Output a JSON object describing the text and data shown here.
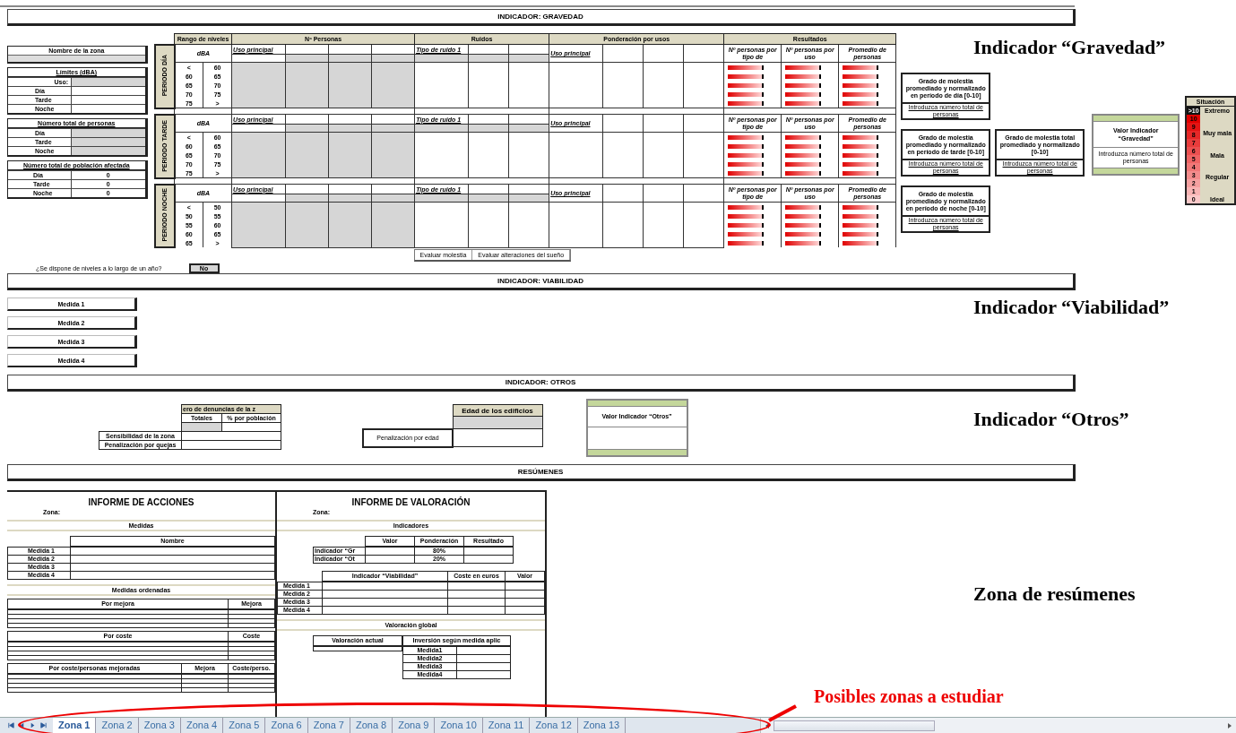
{
  "gravedad": {
    "title": "INDICADOR: GRAVEDAD",
    "zone": {
      "label": "Nombre de la zona"
    },
    "limits": {
      "title": "Límites (dBA)",
      "use_label": "Uso:",
      "rows": [
        "Día",
        "Tarde",
        "Noche"
      ]
    },
    "people": {
      "title": "Número total de personas",
      "rows": [
        "Día",
        "Tarde",
        "Noche"
      ]
    },
    "affected": {
      "title": "Número total de población afectada",
      "rows": [
        {
          "label": "Día",
          "value": "0"
        },
        {
          "label": "Tarde",
          "value": "0"
        },
        {
          "label": "Noche",
          "value": "0"
        }
      ]
    },
    "columns": {
      "range": "Rango de niveles",
      "persons": "Nº Personas",
      "noise": "Ruidos",
      "weighting": "Ponderación por usos",
      "results": "Resultados"
    },
    "periods": [
      {
        "label": "PERIODO DÍA",
        "unit": "dBA",
        "persons_header": "Uso principal",
        "noise_header": "Tipo de ruido 1",
        "weighting_header": "Uso principal",
        "result_headers": [
          "Nº personas por tipo de",
          "Nº personas por uso",
          "Promedio de personas"
        ],
        "ranges": [
          [
            "<",
            "60"
          ],
          [
            "60",
            "65"
          ],
          [
            "65",
            "70"
          ],
          [
            "70",
            "75"
          ],
          [
            "75",
            ">"
          ]
        ]
      },
      {
        "label": "PERIODO TARDE",
        "unit": "dBA",
        "persons_header": "Uso principal",
        "noise_header": "Tipo de ruido 1",
        "weighting_header": "Uso principal",
        "result_headers": [
          "Nº personas por tipo de",
          "Nº personas por uso",
          "Promedio de personas"
        ],
        "ranges": [
          [
            "<",
            "60"
          ],
          [
            "60",
            "65"
          ],
          [
            "65",
            "70"
          ],
          [
            "70",
            "75"
          ],
          [
            "75",
            ">"
          ]
        ]
      },
      {
        "label": "PERIODO NOCHE",
        "unit": "dBA",
        "persons_header": "Uso principal",
        "noise_header": "Tipo de ruido 1",
        "weighting_header": "Uso principal",
        "result_headers": [
          "Nº personas por tipo de",
          "Nº personas por uso",
          "Promedio de personas"
        ],
        "ranges": [
          [
            "<",
            "50"
          ],
          [
            "50",
            "55"
          ],
          [
            "55",
            "60"
          ],
          [
            "60",
            "65"
          ],
          [
            "65",
            ">"
          ]
        ]
      }
    ],
    "actions": [
      "Evaluar molestia",
      "Evaluar alteraciones del sueño"
    ],
    "summary_boxes": [
      {
        "title": "Grado de molestia promediado y normalizado en período de día [0-10]",
        "note": "Introduzca número total de personas"
      },
      {
        "title": "Grado de molestia promediado y normalizado en período de tarde [0-10]",
        "note": "Introduzca número total de personas"
      },
      {
        "title": "Grado de molestia total promediado y normalizado [0-10]",
        "note": "Introduzca número total de personas"
      },
      {
        "title": "Grado de molestia promediado y normalizado en período de noche [0-10]",
        "note": "Introduzca número total de personas"
      }
    ],
    "indicator": {
      "title": "Valor Indicador “Gravedad”",
      "note": "Introduzca número total de personas"
    },
    "scale": {
      "title": "Situación",
      "steps": [
        ">10",
        "10",
        "9",
        "8",
        "7",
        "6",
        "5",
        "4",
        "3",
        "2",
        "1",
        "0"
      ],
      "labels": [
        "Extremo",
        "Muy mala",
        "Mala",
        "Regular",
        "Ideal"
      ]
    },
    "question": {
      "text": "¿Se dispone de niveles a lo largo de un año?",
      "answer": "No"
    }
  },
  "viabilidad": {
    "title": "INDICADOR: VIABILIDAD",
    "measures": [
      "Medida 1",
      "Medida 2",
      "Medida 3",
      "Medida 4"
    ]
  },
  "otros": {
    "title": "INDICADOR: OTROS",
    "complaints": {
      "header": "ero de denuncias de la z",
      "subheaders": [
        "Totales",
        "% por población"
      ],
      "rows": [
        "Sensibilidad de la zona",
        "Penalización por quejas"
      ]
    },
    "age": {
      "header": "Edad de los edificios",
      "row": "Penalización por edad"
    },
    "indicator": {
      "title": "Valor Indicador “Otros”"
    }
  },
  "resumenes": {
    "title": "RESÚMENES",
    "acciones": {
      "title": "INFORME DE ACCIONES",
      "zone": "Zona:",
      "measures_band": "Medidas",
      "name_header": "Nombre",
      "measures": [
        "Medida 1",
        "Medida 2",
        "Medida 3",
        "Medida 4"
      ],
      "ordered_band": "Medidas ordenadas",
      "tables": [
        {
          "headers": [
            "Por mejora",
            "Mejora"
          ]
        },
        {
          "headers": [
            "Por coste",
            "Coste"
          ]
        },
        {
          "headers": [
            "Por coste/personas mejoradas",
            "Mejora",
            "Coste/perso."
          ]
        }
      ]
    },
    "valoracion": {
      "title": "INFORME DE VALORACIÓN",
      "zone": "Zona:",
      "indicators_band": "Indicadores",
      "ind_headers": [
        "Valor",
        "Ponderación",
        "Resultado"
      ],
      "ind_rows": [
        {
          "label": "Indicador “Gr",
          "weight": "80%"
        },
        {
          "label": "Indicador “Ot",
          "weight": "20%"
        }
      ],
      "viab_headers": [
        "Indicador “Viabilidad”",
        "Coste en euros",
        "Valor"
      ],
      "measures": [
        "Medida 1",
        "Medida 2",
        "Medida 3",
        "Medida 4"
      ],
      "global_band": "Valoración global",
      "current_header": "Valoración actual",
      "invest_header": "Inversión según medida aplic",
      "invest_rows": [
        "Medida1",
        "Medida2",
        "Medida3",
        "Medida4"
      ]
    }
  },
  "tabs": [
    {
      "label": "Zona 1",
      "selected": true
    },
    {
      "label": "Zona 2",
      "selected": false
    },
    {
      "label": "Zona 3",
      "selected": false
    },
    {
      "label": "Zona 4",
      "selected": false
    },
    {
      "label": "Zona 5",
      "selected": false
    },
    {
      "label": "Zona 6",
      "selected": false
    },
    {
      "label": "Zona 7",
      "selected": false
    },
    {
      "label": "Zona 8",
      "selected": false
    },
    {
      "label": "Zona 9",
      "selected": false
    },
    {
      "label": "Zona 10",
      "selected": false
    },
    {
      "label": "Zona 11",
      "selected": false
    },
    {
      "label": "Zona 12",
      "selected": false
    },
    {
      "label": "Zona 13",
      "selected": false
    }
  ],
  "annotations": {
    "gravedad": "Indicador “Gravedad”",
    "viabilidad": "Indicador “Viabilidad”",
    "otros": "Indicador “Otros”",
    "resumenes": "Zona de resúmenes",
    "callout": "Posibles zonas a estudiar"
  }
}
